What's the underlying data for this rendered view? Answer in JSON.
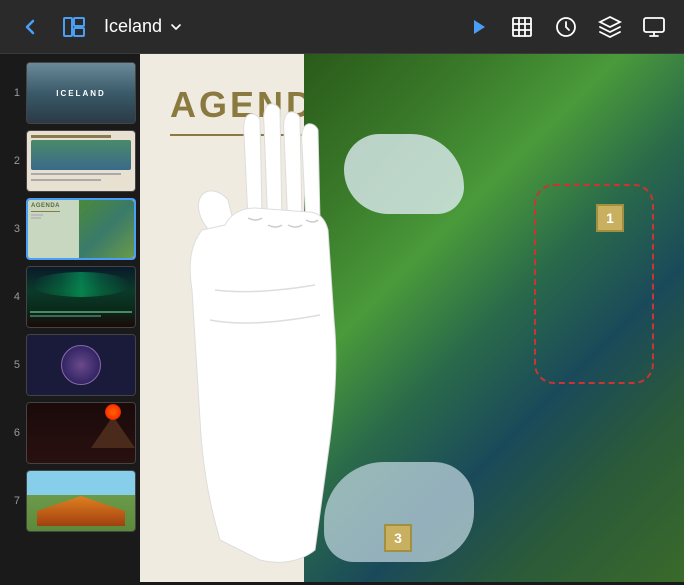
{
  "app": {
    "title": "Iceland",
    "toolbar": {
      "back_label": "back",
      "play_label": "play",
      "table_label": "table",
      "clock_label": "clock",
      "stack_label": "stack",
      "screen_label": "screen"
    }
  },
  "slides": [
    {
      "number": "1",
      "label": "Iceland title slide"
    },
    {
      "number": "2",
      "label": "Content slide"
    },
    {
      "number": "3",
      "label": "Agenda slide",
      "active": true
    },
    {
      "number": "4",
      "label": "Aurora slide"
    },
    {
      "number": "5",
      "label": "Diagram slide"
    },
    {
      "number": "6",
      "label": "Volcano slide"
    },
    {
      "number": "7",
      "label": "Landscape slide"
    }
  ],
  "current_slide": {
    "title": "AGENDA"
  },
  "map": {
    "number_1": "1",
    "number_3": "3"
  }
}
